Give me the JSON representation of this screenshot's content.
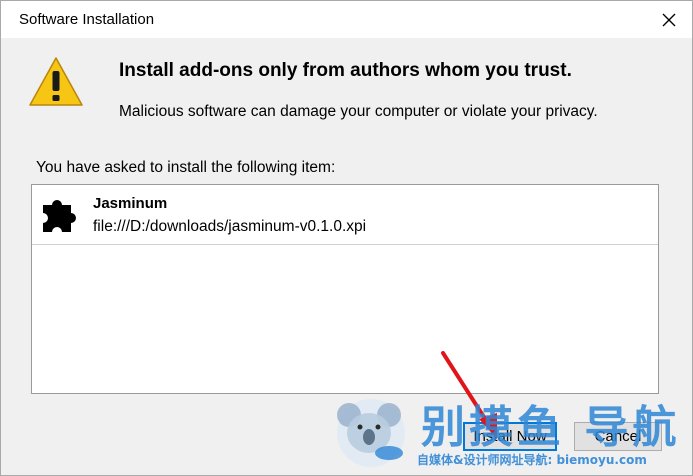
{
  "window": {
    "title": "Software Installation",
    "close_icon": "close-icon"
  },
  "warning": {
    "icon": "warning-icon",
    "headline": "Install add-ons only from authors whom you trust.",
    "subtext": "Malicious software can damage your computer or violate your privacy."
  },
  "list": {
    "caption": "You have asked to install the following item:",
    "items": [
      {
        "icon": "puzzle-piece-icon",
        "name": "Jasminum",
        "url": "file:///D:/downloads/jasminum-v0.1.0.xpi"
      }
    ]
  },
  "buttons": {
    "install": "Install Now",
    "cancel": "Cancel"
  },
  "watermark": {
    "title": "别摸鱼 导航",
    "tagline": "自媒体&设计师网址导航: biemoyu.com"
  },
  "colors": {
    "dialog_bg": "#f0f0f0",
    "warning_yellow": "#f7c615",
    "focus_blue": "#0078d7",
    "annotation_red": "#e0141a",
    "watermark_blue": "#2f86d6"
  }
}
